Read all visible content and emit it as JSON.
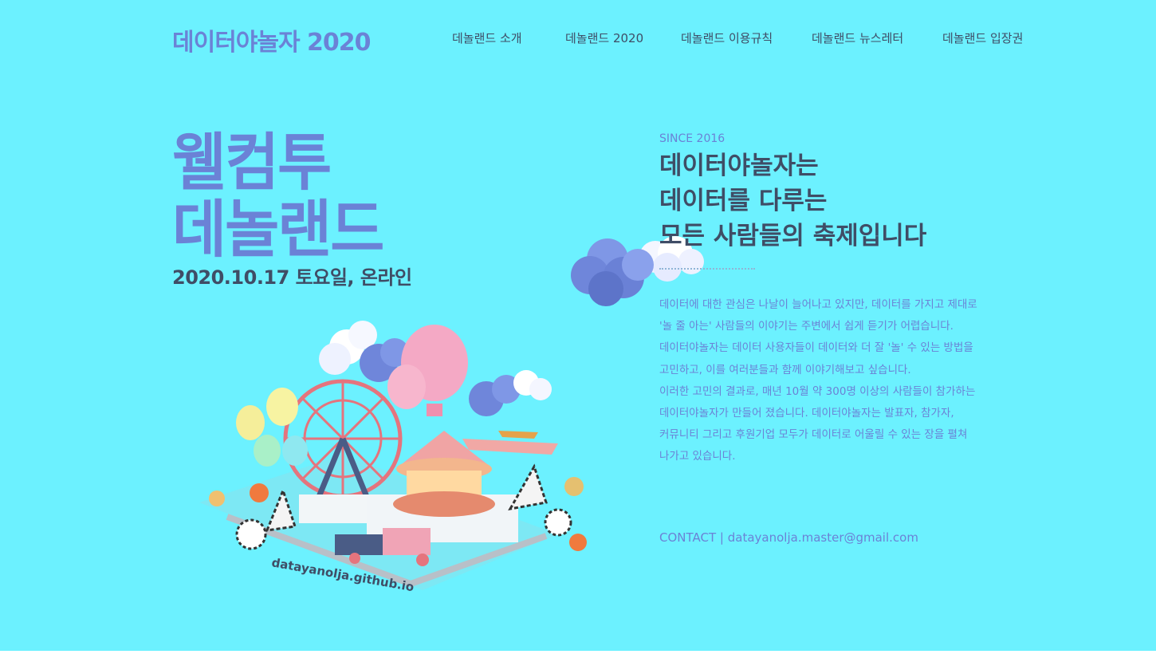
{
  "header": {
    "logo": "데이터야놀자 2020",
    "nav": [
      "데놀랜드 소개",
      "데놀랜드 2020",
      "데놀랜드 이용규칙",
      "데놀랜드 뉴스레터",
      "데놀랜드 입장권"
    ]
  },
  "hero": {
    "title_line1": "웰컴투",
    "title_line2": "데놀랜드",
    "date": "2020.10.17 토요일, 온라인",
    "illustration_url": "datayanolja.github.io"
  },
  "intro": {
    "since": "SINCE 2016",
    "headline": [
      "데이터야놀자는",
      "데이터를 다루는",
      "모든 사람들의 축제입니다"
    ],
    "description": [
      "데이터에 대한 관심은 나날이 늘어나고 있지만, 데이터를 가지고 제대로",
      "'놀 줄 아는' 사람들의 이야기는 주변에서 쉽게 듣기가 어렵습니다.",
      "데이터야놀자는 데이터 사용자들이 데이터와 더 잘 '놀' 수 있는 방법을",
      "고민하고, 이를 여러분들과 함께 이야기해보고 싶습니다.",
      "이러한 고민의 결과로, 매년 10월 약 300명 이상의 사람들이 참가하는",
      "데이터야놀자가 만들어 졌습니다. 데이터야놀자는 발표자, 참가자,",
      "커뮤니티 그리고 후원기업 모두가 데이터로 어울릴 수 있는 장을 펼쳐",
      "나가고 있습니다."
    ],
    "contact_label": "CONTACT |",
    "contact_email": "datayanolja.master@gmail.com"
  },
  "colors": {
    "background": "#6cf1ff",
    "accent": "#6b82d6",
    "text_dark": "#3f4d66"
  }
}
